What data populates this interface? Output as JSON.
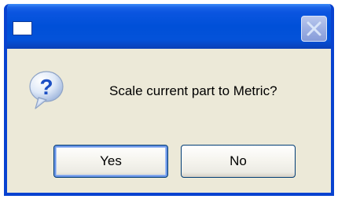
{
  "dialog": {
    "title": "",
    "message": "Scale current part to Metric?",
    "icon": "question-icon",
    "buttons": {
      "yes_label": "Yes",
      "no_label": "No"
    }
  },
  "titlebar": {
    "app_icon": "window-icon",
    "close_icon": "close-icon"
  },
  "colors": {
    "titlebar": "#0050d8",
    "dialog_bg": "#ece9d8",
    "button_border": "#003c74",
    "focus_ring": "#6a94e6"
  }
}
